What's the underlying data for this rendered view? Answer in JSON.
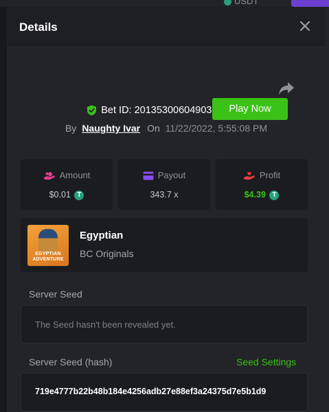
{
  "background": {
    "currency": "USDT"
  },
  "modal": {
    "title": "Details"
  },
  "bet": {
    "id_label": "Bet ID: 20135300604903331",
    "by_label": "By",
    "username": "Naughty Ivar",
    "on_label": "On",
    "datetime": "11/22/2022, 5:55:08 PM"
  },
  "stats": {
    "amount": {
      "label": "Amount",
      "value": "$0.01",
      "icon": "hand-coins-icon",
      "color": "#e83e8c"
    },
    "payout": {
      "label": "Payout",
      "value": "343.7 x",
      "icon": "wallet-icon",
      "color": "#8a4df0"
    },
    "profit": {
      "label": "Profit",
      "value": "$4.39",
      "icon": "hand-heart-icon",
      "color": "#e83e3e"
    },
    "currency_icon": "T"
  },
  "game": {
    "thumb_text": "EGYPTIAN ADVENTURE",
    "name": "Egyptian",
    "provider": "BC Originals",
    "play_label": "Play Now"
  },
  "server_seed": {
    "label": "Server Seed",
    "message": "The Seed hasn't been revealed yet."
  },
  "server_seed_hash": {
    "label": "Server Seed (hash)",
    "settings_label": "Seed Settings",
    "value": "719e4777b22b48b184e4256adb27e88ef3a24375d7e5b1d9"
  },
  "colors": {
    "accent_green": "#3bc117",
    "shield_green": "#3bc117"
  }
}
